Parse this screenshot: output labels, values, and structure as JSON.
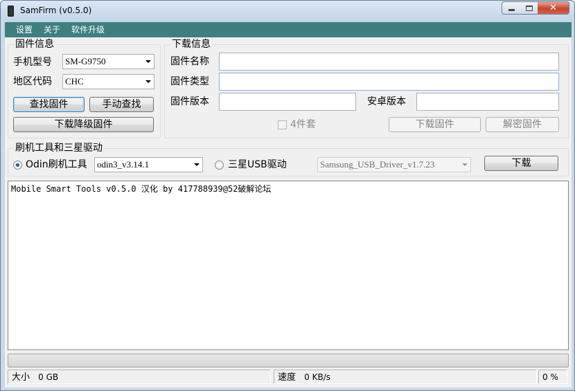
{
  "window": {
    "title": "SamFirm  (v0.5.0)",
    "controls": {
      "minimize": "minimize",
      "maximize": "maximize",
      "close": "✕"
    }
  },
  "menu": [
    "设置",
    "关于",
    "软件升级"
  ],
  "firmware_info": {
    "title": "固件信息",
    "model_label": "手机型号",
    "model_value": "SM-G9750",
    "region_label": "地区代码",
    "region_value": "CHC",
    "find_button": "查找固件",
    "manual_find_button": "手动查找",
    "download_downgrade_button": "下载降级固件"
  },
  "download_info": {
    "title": "下载信息",
    "name_label": "固件名称",
    "name_value": "",
    "type_label": "固件类型",
    "type_value": "",
    "version_label": "固件版本",
    "version_value": "",
    "android_label": "安卓版本",
    "android_value": "",
    "four_pack_label": "4件套",
    "four_pack_checked": false,
    "download_button": "下载固件",
    "decrypt_button": "解密固件"
  },
  "flash_tools": {
    "title": "刷机工具和三星驱动",
    "odin_radio_label": "Odin刷机工具",
    "odin_selected": true,
    "odin_version": "odin3_v3.14.1",
    "usb_radio_label": "三星USB驱动",
    "usb_driver_version": "Samsung_USB_Driver_v1.7.23",
    "download_button": "下载"
  },
  "log": {
    "lines": [
      "Mobile Smart Tools v0.5.0 汉化 by 417788939@52破解论坛"
    ]
  },
  "progress": {
    "fraction": 0.0
  },
  "status": {
    "size_label": "大小",
    "size_value": "0 GB",
    "speed_label": "速度",
    "speed_value": "0 KB/s",
    "percent": "0 %"
  }
}
